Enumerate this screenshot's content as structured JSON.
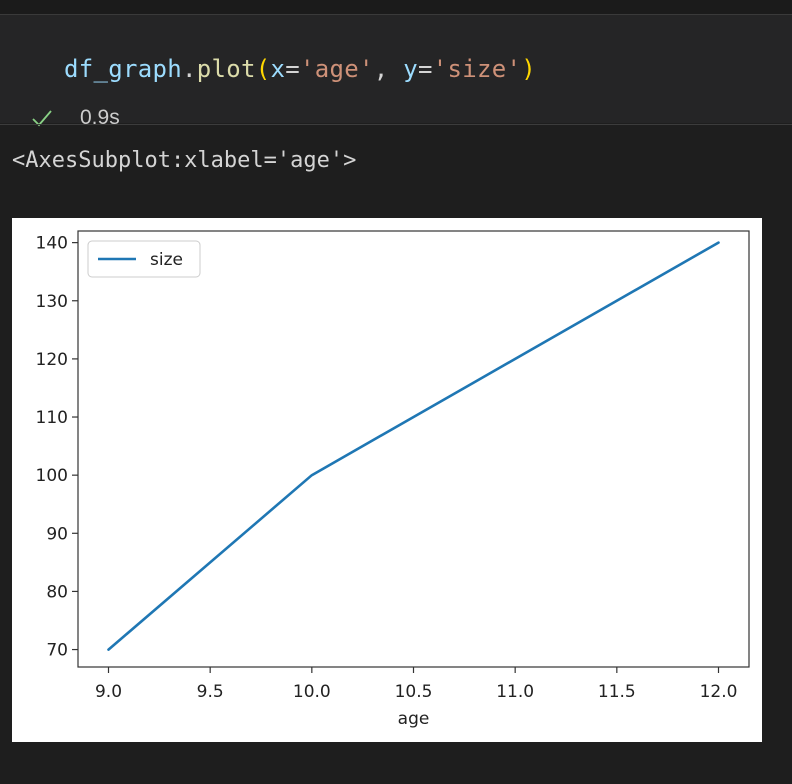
{
  "cell": {
    "code": {
      "var": "df_graph",
      "dot": ".",
      "func": "plot",
      "open_paren": "(",
      "arg1_name": "x",
      "eq": "=",
      "arg1_value": "'age'",
      "comma": ", ",
      "arg2_name": "y",
      "arg2_value": "'size'",
      "close_paren": ")"
    },
    "status": {
      "icon": "check-icon",
      "exec_time": "0.9s",
      "color": "#89d185"
    }
  },
  "output": {
    "repr": "<AxesSubplot:xlabel='age'>"
  },
  "colors": {
    "line": "#1f77b4",
    "background": "#1e1e1e",
    "plot_bg": "#ffffff"
  },
  "chart_data": {
    "type": "line",
    "x": [
      9.0,
      10.0,
      12.0
    ],
    "series": [
      {
        "name": "size",
        "values": [
          70,
          100,
          140
        ]
      }
    ],
    "xlabel": "age",
    "ylabel": "",
    "xlim": [
      8.85,
      12.15
    ],
    "ylim": [
      67,
      142
    ],
    "xticks": [
      "9.0",
      "9.5",
      "10.0",
      "10.5",
      "11.0",
      "11.5",
      "12.0"
    ],
    "yticks": [
      "70",
      "80",
      "90",
      "100",
      "110",
      "120",
      "130",
      "140"
    ],
    "legend": {
      "position": "upper-left"
    },
    "grid": false
  }
}
